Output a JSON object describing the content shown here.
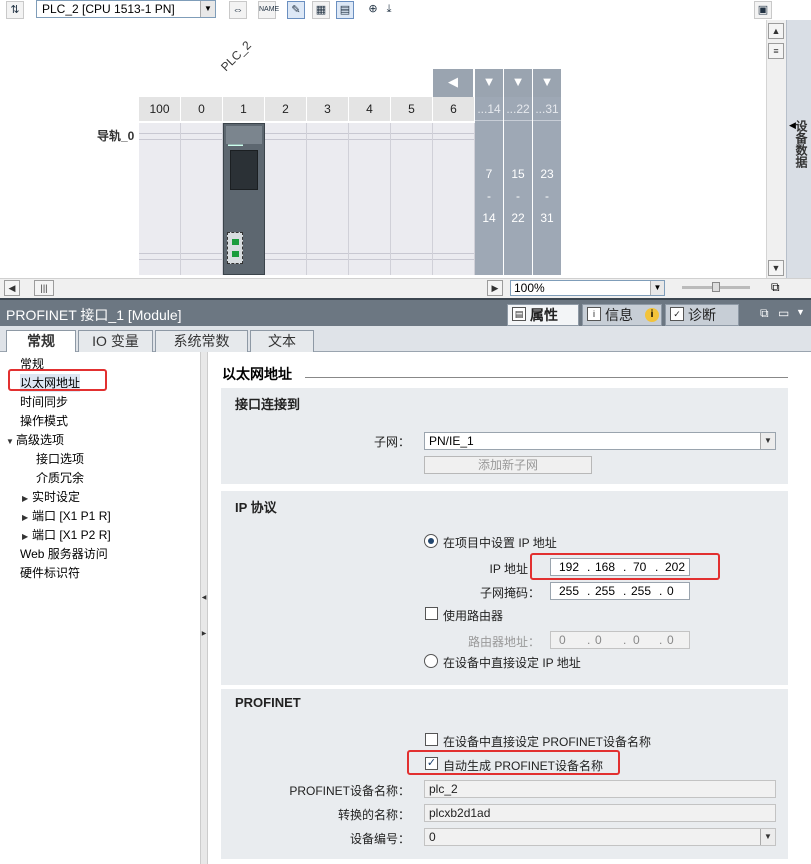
{
  "device_view": {
    "device_select": "PLC_2 [CPU 1513-1 PN]",
    "plc_label": "PLC_2",
    "rail_label": "导轨_0",
    "slots": [
      "100",
      "0",
      "1",
      "2",
      "3",
      "4",
      "5",
      "6"
    ],
    "extra_cols": [
      {
        "head": "...14",
        "top": "7",
        "dash": "-",
        "bottom": "14"
      },
      {
        "head": "...22",
        "top": "15",
        "dash": "-",
        "bottom": "22"
      },
      {
        "head": "...31",
        "top": "23",
        "dash": "-",
        "bottom": "31"
      }
    ],
    "zoom": "100%",
    "side_tab": "设备数据",
    "hscroll_thumb": "|||"
  },
  "inspector": {
    "title": "PROFINET 接口_1 [Module]",
    "right_tabs": {
      "properties": "属性",
      "info": "信息",
      "diagnostics": "诊断",
      "info_badge": "i"
    },
    "tabs": [
      "常规",
      "IO 变量",
      "系统常数",
      "文本"
    ],
    "nav": [
      "常规",
      "以太网地址",
      "时间同步",
      "操作模式",
      "高级选项",
      "接口选项",
      "介质冗余",
      "实时设定",
      "端口 [X1 P1 R]",
      "端口 [X1 P2 R]",
      "Web 服务器访问",
      "硬件标识符"
    ],
    "section_title": "以太网地址",
    "interface": {
      "group_title": "接口连接到",
      "subnet_label": "子网：",
      "subnet_value": "PN/IE_1",
      "add_subnet": "添加新子网"
    },
    "ip": {
      "group_title": "IP 协议",
      "set_in_project": "在项目中设置 IP 地址",
      "ip_label": "IP 地址：",
      "ip": [
        "192",
        "168",
        "70",
        "202"
      ],
      "mask_label": "子网掩码：",
      "mask": [
        "255",
        "255",
        "255",
        "0"
      ],
      "use_router": "使用路由器",
      "router_label": "路由器地址：",
      "router": [
        "0",
        "0",
        "0",
        "0"
      ],
      "set_in_device": "在设备中直接设定 IP 地址",
      "dot": "."
    },
    "profinet": {
      "group_title": "PROFINET",
      "set_name_in_device": "在设备中直接设定 PROFINET设备名称",
      "auto_name": "自动生成 PROFINET设备名称",
      "name_label": "PROFINET设备名称：",
      "name_value": "plc_2",
      "converted_label": "转换的名称：",
      "converted_value": "plcxb2d1ad",
      "number_label": "设备编号：",
      "number_value": "0"
    }
  },
  "colors": {
    "highlight_box": "#e23030",
    "title_bar": "#6c7782",
    "group_bg": "#e9ecef"
  }
}
